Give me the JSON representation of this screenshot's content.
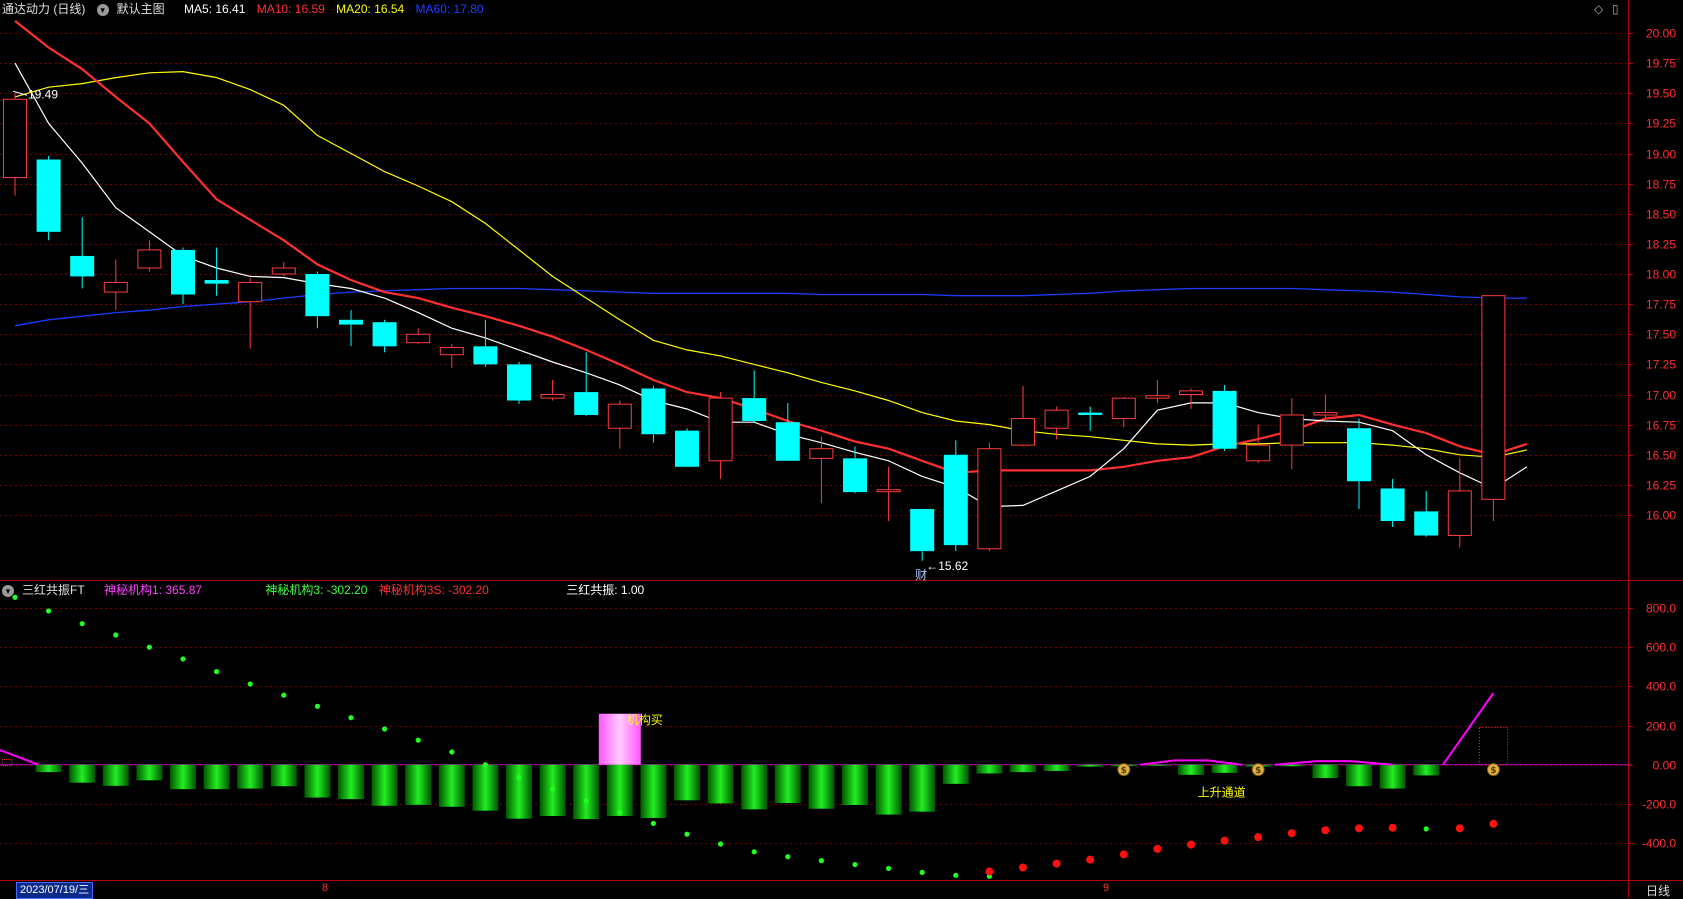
{
  "main_header": {
    "stock_name": "通达动力 (日线)",
    "template_label": "默认主图",
    "ma5": {
      "label": "MA5: 16.41",
      "color": "#ffffff"
    },
    "ma10": {
      "label": "MA10: 16.59",
      "color": "#ff3030"
    },
    "ma20": {
      "label": "MA20: 16.54",
      "color": "#ffff00"
    },
    "ma60": {
      "label": "MA60: 17.80",
      "color": "#1a3cff"
    }
  },
  "indicator_header": {
    "name": "三红共振FT",
    "v1": {
      "label": "神秘机构1: 365.87",
      "color": "#ff40ff"
    },
    "v3": {
      "label": "神秘机构3: -302.20",
      "color": "#40ff40"
    },
    "v3s": {
      "label": "神秘机构3S: -302.20",
      "color": "#ff3030"
    },
    "resonance": {
      "label": "三红共振: 1.00",
      "color": "#ffffff"
    }
  },
  "footer": {
    "date_box": "2023/07/19/三",
    "month_aug": "8",
    "month_sep": "9",
    "period_label": "日线"
  },
  "colors": {
    "up": "#ff3b3b",
    "down": "#00ffff",
    "grid": "#7a0000",
    "axis_text": "#ff3030",
    "green_bar": "#00cc00",
    "pink_bar": "#ff66ff"
  },
  "chart_data": [
    {
      "type": "candlestick",
      "ylim": [
        15.6,
        20.1
      ],
      "yticks": [
        "20.00",
        "19.75",
        "19.50",
        "19.25",
        "19.00",
        "18.75",
        "18.50",
        "18.25",
        "18.00",
        "17.75",
        "17.50",
        "17.25",
        "17.00",
        "16.75",
        "16.50",
        "16.25",
        "16.00"
      ],
      "candles": [
        {
          "o": 18.8,
          "c": 19.45,
          "h": 19.5,
          "l": 18.65
        },
        {
          "o": 18.95,
          "c": 18.35,
          "h": 18.98,
          "l": 18.28
        },
        {
          "o": 18.15,
          "c": 17.98,
          "h": 18.47,
          "l": 17.88
        },
        {
          "o": 17.85,
          "c": 17.93,
          "h": 18.12,
          "l": 17.7
        },
        {
          "o": 18.05,
          "c": 18.2,
          "h": 18.28,
          "l": 18.02
        },
        {
          "o": 18.2,
          "c": 17.83,
          "h": 18.22,
          "l": 17.75
        },
        {
          "o": 17.95,
          "c": 17.92,
          "h": 18.22,
          "l": 17.82
        },
        {
          "o": 17.77,
          "c": 17.93,
          "h": 17.97,
          "l": 17.38
        },
        {
          "o": 18.0,
          "c": 18.05,
          "h": 18.1,
          "l": 17.98
        },
        {
          "o": 18.0,
          "c": 17.65,
          "h": 18.02,
          "l": 17.55
        },
        {
          "o": 17.62,
          "c": 17.58,
          "h": 17.7,
          "l": 17.4
        },
        {
          "o": 17.6,
          "c": 17.4,
          "h": 17.62,
          "l": 17.35
        },
        {
          "o": 17.43,
          "c": 17.5,
          "h": 17.55,
          "l": 17.42
        },
        {
          "o": 17.33,
          "c": 17.39,
          "h": 17.42,
          "l": 17.22
        },
        {
          "o": 17.4,
          "c": 17.25,
          "h": 17.62,
          "l": 17.23
        },
        {
          "o": 17.25,
          "c": 16.95,
          "h": 17.27,
          "l": 16.92
        },
        {
          "o": 16.97,
          "c": 17.0,
          "h": 17.12,
          "l": 16.95
        },
        {
          "o": 17.02,
          "c": 16.83,
          "h": 17.35,
          "l": 16.82
        },
        {
          "o": 16.72,
          "c": 16.92,
          "h": 16.95,
          "l": 16.55
        },
        {
          "o": 17.05,
          "c": 16.67,
          "h": 17.07,
          "l": 16.6
        },
        {
          "o": 16.7,
          "c": 16.4,
          "h": 16.72,
          "l": 16.4
        },
        {
          "o": 16.45,
          "c": 16.97,
          "h": 17.02,
          "l": 16.3
        },
        {
          "o": 16.97,
          "c": 16.78,
          "h": 17.2,
          "l": 16.77
        },
        {
          "o": 16.77,
          "c": 16.45,
          "h": 16.93,
          "l": 16.45
        },
        {
          "o": 16.47,
          "c": 16.55,
          "h": 16.65,
          "l": 16.1
        },
        {
          "o": 16.47,
          "c": 16.19,
          "h": 16.57,
          "l": 16.18
        },
        {
          "o": 16.21,
          "c": 16.21,
          "h": 16.4,
          "l": 15.95
        },
        {
          "o": 16.05,
          "c": 15.7,
          "h": 16.05,
          "l": 15.62
        },
        {
          "o": 16.5,
          "c": 15.75,
          "h": 16.62,
          "l": 15.7
        },
        {
          "o": 15.72,
          "c": 16.55,
          "h": 16.6,
          "l": 15.7
        },
        {
          "o": 16.58,
          "c": 16.8,
          "h": 17.07,
          "l": 16.57
        },
        {
          "o": 16.72,
          "c": 16.87,
          "h": 16.9,
          "l": 16.63
        },
        {
          "o": 16.85,
          "c": 16.83,
          "h": 16.9,
          "l": 16.7
        },
        {
          "o": 16.8,
          "c": 16.97,
          "h": 16.98,
          "l": 16.73
        },
        {
          "o": 16.97,
          "c": 16.99,
          "h": 17.12,
          "l": 16.93
        },
        {
          "o": 17.0,
          "c": 17.03,
          "h": 17.05,
          "l": 16.88
        },
        {
          "o": 17.03,
          "c": 16.55,
          "h": 17.08,
          "l": 16.53
        },
        {
          "o": 16.45,
          "c": 16.58,
          "h": 16.75,
          "l": 16.43
        },
        {
          "o": 16.58,
          "c": 16.83,
          "h": 16.97,
          "l": 16.38
        },
        {
          "o": 16.83,
          "c": 16.85,
          "h": 17.0,
          "l": 16.78
        },
        {
          "o": 16.72,
          "c": 16.28,
          "h": 16.8,
          "l": 16.05
        },
        {
          "o": 16.22,
          "c": 15.95,
          "h": 16.3,
          "l": 15.9
        },
        {
          "o": 16.03,
          "c": 15.83,
          "h": 16.2,
          "l": 15.82
        },
        {
          "o": 15.83,
          "c": 16.2,
          "h": 16.47,
          "l": 15.73
        },
        {
          "o": 16.13,
          "c": 17.82,
          "h": 17.82,
          "l": 15.95
        }
      ],
      "ma5": [
        19.75,
        19.25,
        18.92,
        18.55,
        18.35,
        18.15,
        18.05,
        17.98,
        17.97,
        17.92,
        17.88,
        17.8,
        17.68,
        17.55,
        17.47,
        17.37,
        17.27,
        17.18,
        17.08,
        16.95,
        16.88,
        16.77,
        16.77,
        16.67,
        16.6,
        16.52,
        16.45,
        16.32,
        16.23,
        16.07,
        16.08,
        16.2,
        16.32,
        16.55,
        16.87,
        16.93,
        16.93,
        16.85,
        16.8,
        16.78,
        16.77,
        16.7,
        16.5,
        16.35,
        16.22,
        16.4
      ],
      "ma10": [
        20.1,
        19.88,
        19.7,
        19.47,
        19.25,
        18.93,
        18.62,
        18.45,
        18.28,
        18.08,
        17.95,
        17.85,
        17.8,
        17.72,
        17.65,
        17.57,
        17.48,
        17.37,
        17.25,
        17.12,
        17.02,
        16.97,
        16.88,
        16.78,
        16.7,
        16.61,
        16.55,
        16.45,
        16.35,
        16.37,
        16.37,
        16.37,
        16.37,
        16.4,
        16.45,
        16.48,
        16.57,
        16.63,
        16.7,
        16.8,
        16.83,
        16.75,
        16.68,
        16.57,
        16.5,
        16.59
      ],
      "ma20": [
        19.47,
        19.55,
        19.58,
        19.63,
        19.67,
        19.68,
        19.63,
        19.53,
        19.4,
        19.15,
        19.0,
        18.85,
        18.73,
        18.6,
        18.42,
        18.2,
        17.98,
        17.8,
        17.62,
        17.45,
        17.37,
        17.32,
        17.25,
        17.18,
        17.1,
        17.03,
        16.95,
        16.85,
        16.78,
        16.75,
        16.7,
        16.67,
        16.65,
        16.62,
        16.59,
        16.58,
        16.59,
        16.59,
        16.6,
        16.6,
        16.6,
        16.58,
        16.55,
        16.5,
        16.48,
        16.54
      ],
      "ma60": [
        17.57,
        17.62,
        17.65,
        17.68,
        17.7,
        17.73,
        17.75,
        17.77,
        17.8,
        17.83,
        17.85,
        17.86,
        17.87,
        17.88,
        17.88,
        17.88,
        17.87,
        17.86,
        17.85,
        17.84,
        17.84,
        17.84,
        17.84,
        17.84,
        17.83,
        17.83,
        17.83,
        17.83,
        17.82,
        17.82,
        17.82,
        17.83,
        17.84,
        17.86,
        17.87,
        17.88,
        17.88,
        17.88,
        17.88,
        17.87,
        17.86,
        17.85,
        17.83,
        17.81,
        17.8,
        17.8
      ],
      "annotations": {
        "high": {
          "index": 0,
          "label": "19.49"
        },
        "low": {
          "index": 27,
          "label": "15.62"
        },
        "marker": {
          "index": 27,
          "label": "财"
        }
      }
    },
    {
      "type": "bar",
      "ylim": [
        -470,
        880
      ],
      "yticks": [
        "800.0",
        "600.0",
        "400.0",
        "200.0",
        "0.00",
        "-200.0",
        "-400.0"
      ],
      "bars": [
        0,
        -38,
        -92,
        -108,
        -80,
        -125,
        -125,
        -122,
        -110,
        -168,
        -176,
        -210,
        -205,
        -215,
        -235,
        -276,
        -262,
        -278,
        -262,
        -272,
        -182,
        -198,
        -228,
        -196,
        -225,
        -206,
        -255,
        -240,
        -98,
        -45,
        -38,
        -32,
        -10,
        -8,
        -5,
        -52,
        -42,
        -10,
        -8,
        -68,
        -110,
        -122,
        -55,
        0,
        0
      ],
      "pink_bar": {
        "index": 18,
        "value": 260,
        "label": "机构买"
      },
      "green_dots": [
        855,
        785,
        720,
        662,
        600,
        540,
        475,
        412,
        355,
        298,
        240,
        182,
        125,
        65,
        0,
        -65,
        -125,
        -185,
        -245,
        -300,
        -355,
        -405,
        -445,
        -470,
        -490,
        -510,
        -530,
        -550,
        -565,
        -570
      ],
      "red_dots": [
        {
          "i": 29,
          "v": -545
        },
        {
          "i": 30,
          "v": -525
        },
        {
          "i": 31,
          "v": -505
        },
        {
          "i": 32,
          "v": -485
        },
        {
          "i": 33,
          "v": -458
        },
        {
          "i": 34,
          "v": -430
        },
        {
          "i": 35,
          "v": -408
        },
        {
          "i": 36,
          "v": -388
        },
        {
          "i": 37,
          "v": -370
        },
        {
          "i": 38,
          "v": -350
        },
        {
          "i": 39,
          "v": -335
        },
        {
          "i": 40,
          "v": -325
        },
        {
          "i": 41,
          "v": -322
        },
        {
          "i": 43,
          "v": -325
        },
        {
          "i": 44,
          "v": -302
        }
      ],
      "trailing_green_dot": {
        "i": 42,
        "v": -328
      },
      "pink_line": [
        [
          -0.5,
          78
        ],
        [
          0.7,
          0
        ]
      ],
      "pink_line_end": [
        [
          42.5,
          0
        ],
        [
          44,
          366
        ]
      ],
      "pink_hump": [
        {
          "from": 33.5,
          "to": 36.5,
          "peak": 22
        },
        {
          "from": 37.5,
          "to": 41,
          "peak": 18
        }
      ],
      "money_icons": [
        33,
        37,
        44
      ],
      "text_label": {
        "index": 36,
        "label": "上升通道"
      },
      "dotted_box": {
        "index": 44
      }
    }
  ]
}
